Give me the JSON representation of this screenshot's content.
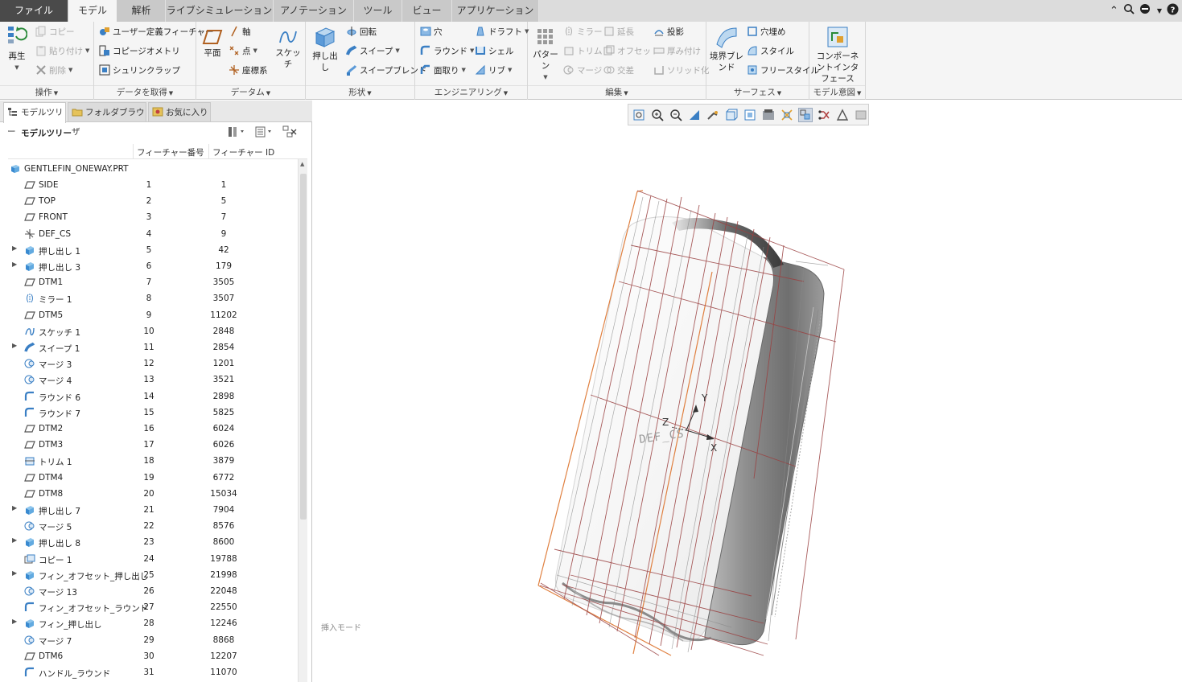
{
  "tabs": [
    {
      "label": "ファイル",
      "name": "tab-file"
    },
    {
      "label": "モデル",
      "name": "tab-model"
    },
    {
      "label": "解析",
      "name": "tab-analysis"
    },
    {
      "label": "ライブシミュレーション",
      "name": "tab-live-simulation"
    },
    {
      "label": "アノテーション",
      "name": "tab-annotation"
    },
    {
      "label": "ツール",
      "name": "tab-tools"
    },
    {
      "label": "ビュー",
      "name": "tab-view"
    },
    {
      "label": "アプリケーション",
      "name": "tab-applications"
    }
  ],
  "ribbon": {
    "operations": {
      "label": "操作",
      "regenerate": "再生",
      "copy": "コピー",
      "paste": "貼り付け",
      "delete": "削除"
    },
    "get_data": {
      "label": "データを取得",
      "udf": "ユーザー定義フィーチャー",
      "copy_geom": "コピージオメトリ",
      "shrinkwrap": "シュリンクラップ"
    },
    "datum": {
      "label": "データム",
      "plane": "平面",
      "axis": "軸",
      "point": "点",
      "csys": "座標系",
      "sketch": "スケッチ"
    },
    "shapes": {
      "label": "形状",
      "extrude": "押し出し",
      "revolve": "回転",
      "sweep": "スイープ",
      "swept_blend": "スイープブレンド"
    },
    "engineering": {
      "label": "エンジニアリング",
      "hole": "穴",
      "round": "ラウンド",
      "chamfer": "面取り",
      "draft": "ドラフト",
      "shell": "シェル",
      "rib": "リブ"
    },
    "editing": {
      "label": "編集",
      "pattern": "パターン",
      "mirror": "ミラー",
      "trim": "トリム",
      "merge": "マージ",
      "extend": "延長",
      "offset": "オフセット",
      "intersect": "交差",
      "project": "投影",
      "thicken": "厚み付け",
      "solidify": "ソリッド化"
    },
    "surfaces": {
      "label": "サーフェス",
      "boundary_blend": "境界ブレンド",
      "fill": "穴埋め",
      "style": "スタイル",
      "freestyle": "フリースタイル"
    },
    "model_intent": {
      "label": "モデル意図",
      "component_interface": "コンポーネントインタフェース"
    }
  },
  "panel": {
    "tabs": {
      "model_tree": "モデルツリー",
      "folder_browser": "フォルダブラウザ",
      "favorites": "お気に入り"
    },
    "tree_title": "モデルツリー",
    "columns": {
      "feat_no": "フィーチャー番号",
      "feat_id": "フィーチャー ID"
    },
    "root": "GENTLEFIN_ONEWAY.PRT",
    "rows": [
      {
        "name": "SIDE",
        "no": "1",
        "id": "1",
        "icon": "datum-plane-icon",
        "expand": false
      },
      {
        "name": "TOP",
        "no": "2",
        "id": "5",
        "icon": "datum-plane-icon",
        "expand": false
      },
      {
        "name": "FRONT",
        "no": "3",
        "id": "7",
        "icon": "datum-plane-icon",
        "expand": false
      },
      {
        "name": "DEF_CS",
        "no": "4",
        "id": "9",
        "icon": "csys-icon",
        "expand": false
      },
      {
        "name": "押し出し 1",
        "no": "5",
        "id": "42",
        "icon": "extrude-icon",
        "expand": true
      },
      {
        "name": "押し出し 3",
        "no": "6",
        "id": "179",
        "icon": "extrude-icon",
        "expand": true
      },
      {
        "name": "DTM1",
        "no": "7",
        "id": "3505",
        "icon": "datum-plane-icon",
        "expand": false
      },
      {
        "name": "ミラー 1",
        "no": "8",
        "id": "3507",
        "icon": "mirror-icon",
        "expand": false
      },
      {
        "name": "DTM5",
        "no": "9",
        "id": "11202",
        "icon": "datum-plane-icon",
        "expand": false
      },
      {
        "name": "スケッチ 1",
        "no": "10",
        "id": "2848",
        "icon": "sketch-icon",
        "expand": false
      },
      {
        "name": "スイープ 1",
        "no": "11",
        "id": "2854",
        "icon": "sweep-icon",
        "expand": true
      },
      {
        "name": "マージ 3",
        "no": "12",
        "id": "1201",
        "icon": "merge-icon",
        "expand": false
      },
      {
        "name": "マージ 4",
        "no": "13",
        "id": "3521",
        "icon": "merge-icon",
        "expand": false
      },
      {
        "name": "ラウンド 6",
        "no": "14",
        "id": "2898",
        "icon": "round-icon",
        "expand": false
      },
      {
        "name": "ラウンド 7",
        "no": "15",
        "id": "5825",
        "icon": "round-icon",
        "expand": false
      },
      {
        "name": "DTM2",
        "no": "16",
        "id": "6024",
        "icon": "datum-plane-icon",
        "expand": false
      },
      {
        "name": "DTM3",
        "no": "17",
        "id": "6026",
        "icon": "datum-plane-icon",
        "expand": false
      },
      {
        "name": "トリム 1",
        "no": "18",
        "id": "3879",
        "icon": "trim-icon",
        "expand": false
      },
      {
        "name": "DTM4",
        "no": "19",
        "id": "6772",
        "icon": "datum-plane-icon",
        "expand": false
      },
      {
        "name": "DTM8",
        "no": "20",
        "id": "15034",
        "icon": "datum-plane-icon",
        "expand": false
      },
      {
        "name": "押し出し 7",
        "no": "21",
        "id": "7904",
        "icon": "extrude-icon",
        "expand": true
      },
      {
        "name": "マージ 5",
        "no": "22",
        "id": "8576",
        "icon": "merge-icon",
        "expand": false
      },
      {
        "name": "押し出し 8",
        "no": "23",
        "id": "8600",
        "icon": "extrude-icon",
        "expand": true
      },
      {
        "name": "コピー 1",
        "no": "24",
        "id": "19788",
        "icon": "copy-icon",
        "expand": false
      },
      {
        "name": "フィン_オフセット_押し出し",
        "no": "25",
        "id": "21998",
        "icon": "extrude-icon",
        "expand": true
      },
      {
        "name": "マージ 13",
        "no": "26",
        "id": "22048",
        "icon": "merge-icon",
        "expand": false
      },
      {
        "name": "フィン_オフセット_ラウンド",
        "no": "27",
        "id": "22550",
        "icon": "round-icon",
        "expand": false
      },
      {
        "name": "フィン_押し出し",
        "no": "28",
        "id": "12246",
        "icon": "extrude-icon",
        "expand": true
      },
      {
        "name": "マージ 7",
        "no": "29",
        "id": "8868",
        "icon": "merge-icon",
        "expand": false
      },
      {
        "name": "DTM6",
        "no": "30",
        "id": "12207",
        "icon": "datum-plane-icon",
        "expand": false
      },
      {
        "name": "ハンドル_ラウンド",
        "no": "31",
        "id": "11070",
        "icon": "round-icon",
        "expand": false
      }
    ]
  },
  "viewport": {
    "mode_text": "挿入モード",
    "csys_label": "DEF_CS",
    "axis_x": "X",
    "axis_y": "Y",
    "axis_z": "Z"
  },
  "colors": {
    "accent_blue": "#3a7fc4",
    "file_tab": "#4a4a4a",
    "edge_orange": "#e08040",
    "datum_red": "#a04040"
  }
}
